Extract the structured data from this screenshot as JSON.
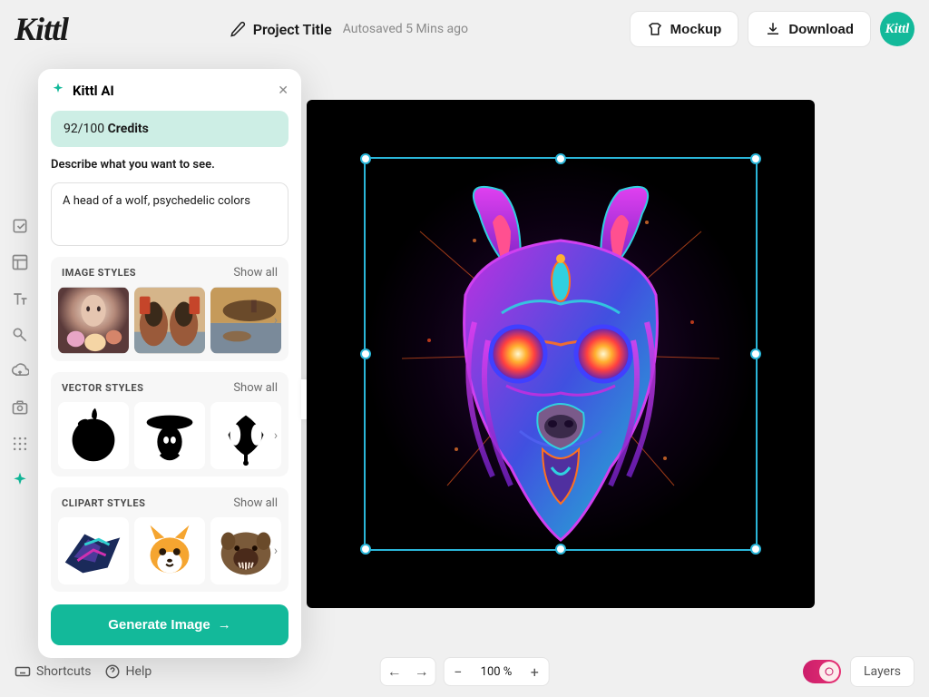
{
  "brand": "Kittl",
  "header": {
    "project_title": "Project Title",
    "autosave": "Autosaved 5 Mins ago",
    "mockup_label": "Mockup",
    "download_label": "Download",
    "avatar_label": "Kittl"
  },
  "ai_panel": {
    "title": "Kittl AI",
    "credits_used": "92/100",
    "credits_label": "Credits",
    "describe_label": "Describe what you want to see.",
    "prompt_value": "A head of a wolf, psychedelic colors ",
    "sections": {
      "image": {
        "title": "IMAGE STYLES",
        "show_all": "Show all"
      },
      "vector": {
        "title": "VECTOR STYLES",
        "show_all": "Show all"
      },
      "clipart": {
        "title": "CLIPART STYLES",
        "show_all": "Show all"
      }
    },
    "generate_label": "Generate Image"
  },
  "zoom": {
    "level": "100 %"
  },
  "bottom": {
    "shortcuts": "Shortcuts",
    "help": "Help",
    "layers": "Layers"
  }
}
